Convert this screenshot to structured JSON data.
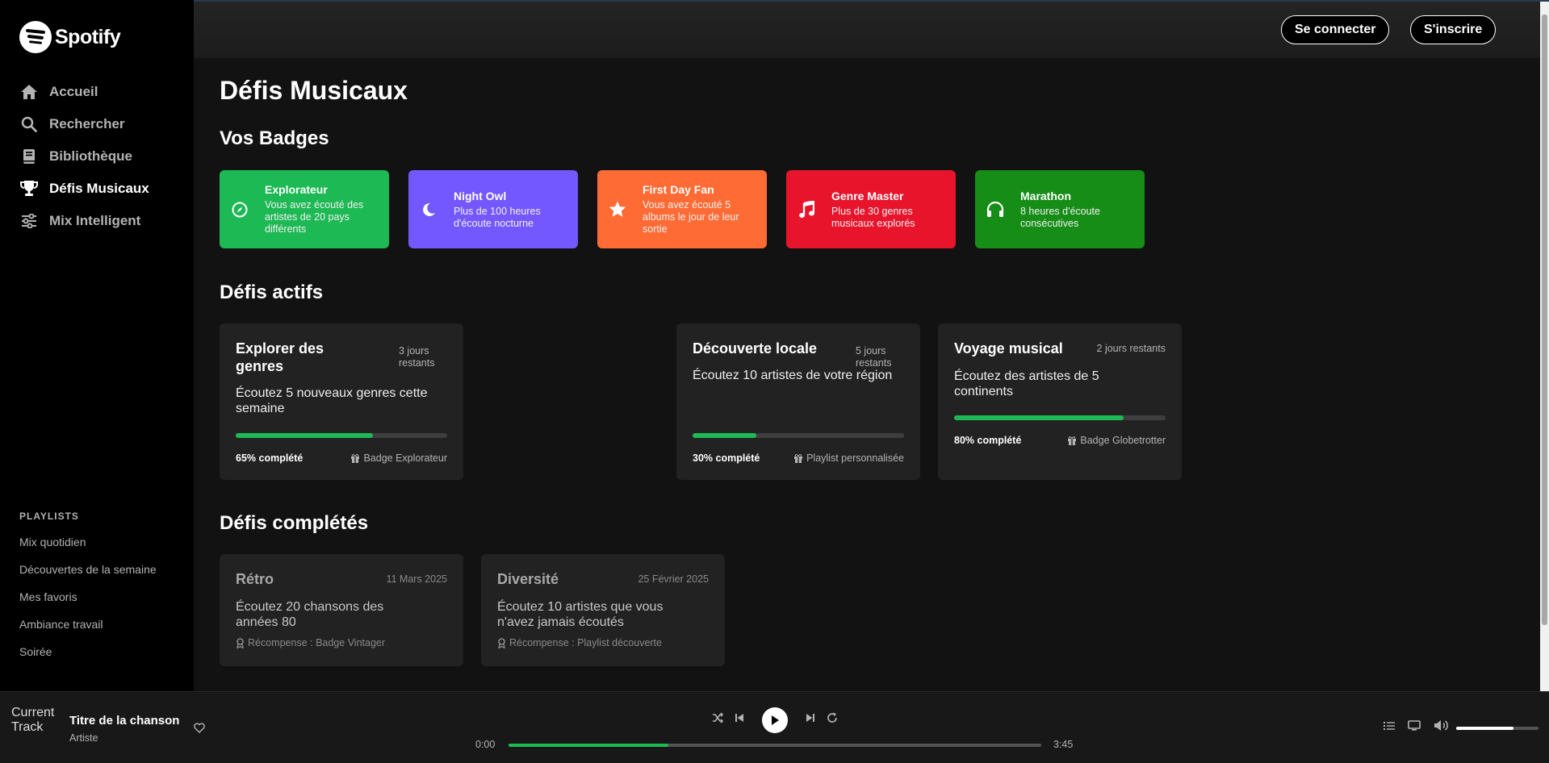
{
  "brand": {
    "name": "Spotify"
  },
  "sidebar": {
    "nav": [
      {
        "label": "Accueil",
        "icon": "home-icon",
        "active": false
      },
      {
        "label": "Rechercher",
        "icon": "search-icon",
        "active": false
      },
      {
        "label": "Bibliothèque",
        "icon": "library-icon",
        "active": false
      },
      {
        "label": "Défis Musicaux",
        "icon": "trophy-icon",
        "active": true
      },
      {
        "label": "Mix Intelligent",
        "icon": "sliders-icon",
        "active": false
      }
    ],
    "playlists_heading": "PLAYLISTS",
    "playlists": [
      "Mix quotidien",
      "Découvertes de la semaine",
      "Mes favoris",
      "Ambiance travail",
      "Soirée"
    ]
  },
  "header": {
    "login_label": "Se connecter",
    "signup_label": "S'inscrire"
  },
  "main": {
    "title": "Défis Musicaux",
    "badges_heading": "Vos Badges",
    "badges": [
      {
        "title": "Explorateur",
        "desc": "Vous avez écouté des artistes de 20 pays différents",
        "color": "#1db954",
        "icon": "compass-icon"
      },
      {
        "title": "Night Owl",
        "desc": "Plus de 100 heures d'écoute nocturne",
        "color": "#7358ff",
        "icon": "moon-icon"
      },
      {
        "title": "First Day Fan",
        "desc": "Vous avez écouté 5 albums le jour de leur sortie",
        "color": "#ff6b35",
        "icon": "star-icon"
      },
      {
        "title": "Genre Master",
        "desc": "Plus de 30 genres musicaux explorés",
        "color": "#e8142c",
        "icon": "music-note-icon"
      },
      {
        "title": "Marathon",
        "desc": "8 heures d'écoute consécutives",
        "color": "#168d17",
        "icon": "headphones-icon"
      }
    ],
    "active_heading": "Défis actifs",
    "active": [
      {
        "title": "Explorer des genres",
        "days": "3 jours restants",
        "desc": "Écoutez 5 nouveaux genres cette semaine",
        "progress": 0.65,
        "progress_label": "65% complété",
        "reward": "Badge Explorateur"
      },
      {
        "title": "Découverte locale",
        "days": "5 jours restants",
        "desc": "Écoutez 10 artistes de votre région",
        "progress": 0.3,
        "progress_label": "30% complété",
        "reward": "Playlist personnalisée"
      },
      {
        "title": "Voyage musical",
        "days": "2 jours restants",
        "desc": "Écoutez des artistes de 5 continents",
        "progress": 0.8,
        "progress_label": "80% complété",
        "reward": "Badge Globetrotter"
      }
    ],
    "completed_heading": "Défis complétés",
    "completed": [
      {
        "title": "Rétro",
        "date": "11 Mars 2025",
        "desc": "Écoutez 20 chansons des années 80",
        "reward": "Récompense : Badge Vintager"
      },
      {
        "title": "Diversité",
        "date": "25 Février 2025",
        "desc": "Écoutez 10 artistes que vous n'avez jamais écoutés",
        "reward": "Récompense : Playlist découverte"
      }
    ]
  },
  "player": {
    "cover_alt": "Current Track",
    "title": "Titre de la chanson",
    "artist": "Artiste",
    "time_current": "0:00",
    "time_total": "3:45",
    "progress": 0.3,
    "volume": 0.7
  }
}
